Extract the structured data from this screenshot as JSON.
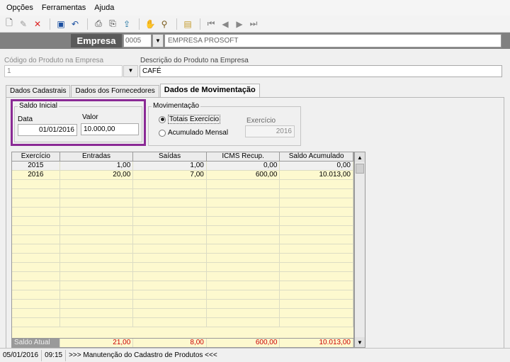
{
  "menu": [
    "Opções",
    "Ferramentas",
    "Ajuda"
  ],
  "toolbar": {
    "icons": [
      "new-icon",
      "edit-icon",
      "delete-icon",
      "save-icon",
      "undo-icon",
      "print-icon",
      "print-preview-icon",
      "export-icon",
      "hand-icon",
      "search-icon",
      "folder-icon",
      "first-record-icon",
      "prev-record-icon",
      "next-record-icon",
      "last-record-icon"
    ]
  },
  "empresa": {
    "label": "Empresa",
    "code": "0005",
    "name": "EMPRESA PROSOFT"
  },
  "produto": {
    "codigo_label": "Código do Produto na Empresa",
    "codigo_value": "1",
    "descricao_label": "Descrição do Produto na Empresa",
    "descricao_value": "CAFÉ"
  },
  "tabs": [
    "Dados Cadastrais",
    "Dados dos Fornecedores",
    "Dados de Movimentação"
  ],
  "saldo_inicial": {
    "title": "Saldo Inicial",
    "data_label": "Data",
    "data_value": "01/01/2016",
    "valor_label": "Valor",
    "valor_value": "10.000,00"
  },
  "movimentacao": {
    "title": "Movimentação",
    "option1": "Totais Exercício",
    "option2": "Acumulado Mensal",
    "selected": "option1",
    "exercicio_label": "Exercício",
    "exercicio_value": "2016"
  },
  "grid": {
    "columns": [
      "Exercício",
      "Entradas",
      "Saídas",
      "ICMS Recup.",
      "Saldo Acumulado"
    ],
    "rows": [
      [
        "2015",
        "1,00",
        "1,00",
        "0,00",
        "0,00"
      ],
      [
        "2016",
        "20,00",
        "7,00",
        "600,00",
        "10.013,00"
      ]
    ],
    "total": [
      "Saldo Atual",
      "21,00",
      "8,00",
      "600,00",
      "10.013,00"
    ]
  },
  "status": {
    "date": "05/01/2016",
    "time": "09:15",
    "message": ">>> Manutenção do Cadastro de Produtos <<<"
  },
  "colors": {
    "highlight": "#8a2a95",
    "grid_bg": "#fdf9cf",
    "total_value": "#cc0000"
  }
}
